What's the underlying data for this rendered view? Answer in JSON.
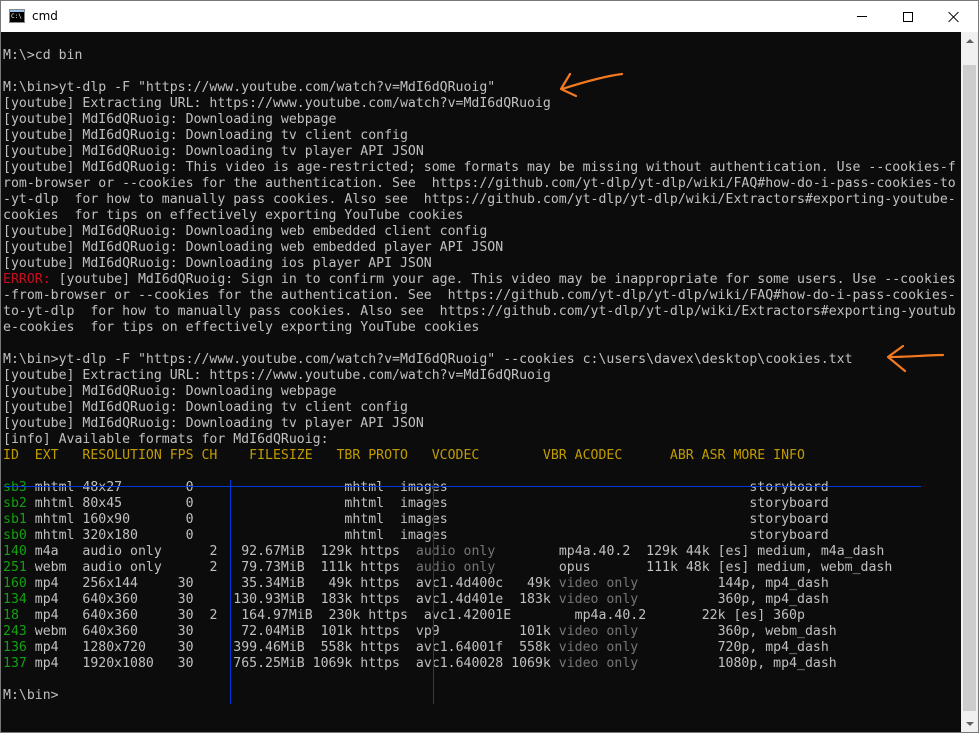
{
  "window": {
    "title": "cmd"
  },
  "colors": {
    "error": "#c50f1f",
    "header": "#c19c00",
    "format_id": "#13a10e",
    "dim": "#767676",
    "separator": "#0037da",
    "annotation": "#f47a1f"
  },
  "terminal": {
    "lines": [
      "M:\\>cd bin",
      "",
      "M:\\bin>yt-dlp -F \"https://www.youtube.com/watch?v=MdI6dQRuoig\"",
      "[youtube] Extracting URL: https://www.youtube.com/watch?v=MdI6dQRuoig",
      "[youtube] MdI6dQRuoig: Downloading webpage",
      "[youtube] MdI6dQRuoig: Downloading tv client config",
      "[youtube] MdI6dQRuoig: Downloading tv player API JSON",
      "[youtube] MdI6dQRuoig: This video is age-restricted; some formats may be missing without authentication. Use --cookies-f",
      "rom-browser or --cookies for the authentication. See  https://github.com/yt-dlp/yt-dlp/wiki/FAQ#how-do-i-pass-cookies-to",
      "-yt-dlp  for how to manually pass cookies. Also see  https://github.com/yt-dlp/yt-dlp/wiki/Extractors#exporting-youtube-",
      "cookies  for tips on effectively exporting YouTube cookies",
      "[youtube] MdI6dQRuoig: Downloading web embedded client config",
      "[youtube] MdI6dQRuoig: Downloading web embedded player API JSON",
      "[youtube] MdI6dQRuoig: Downloading ios player API JSON"
    ],
    "error_label": "ERROR:",
    "error_lines": [
      " [youtube] MdI6dQRuoig: Sign in to confirm your age. This video may be inappropriate for some users. Use --cookies",
      "-from-browser or --cookies for the authentication. See  https://github.com/yt-dlp/yt-dlp/wiki/FAQ#how-do-i-pass-cookies-",
      "to-yt-dlp  for how to manually pass cookies. Also see  https://github.com/yt-dlp/yt-dlp/wiki/Extractors#exporting-youtub",
      "e-cookies  for tips on effectively exporting YouTube cookies"
    ],
    "lines2": [
      "",
      "M:\\bin>yt-dlp -F \"https://www.youtube.com/watch?v=MdI6dQRuoig\" --cookies c:\\users\\davex\\desktop\\cookies.txt",
      "[youtube] Extracting URL: https://www.youtube.com/watch?v=MdI6dQRuoig",
      "[youtube] MdI6dQRuoig: Downloading webpage",
      "[youtube] MdI6dQRuoig: Downloading tv client config",
      "[youtube] MdI6dQRuoig: Downloading tv player API JSON",
      "[info] Available formats for MdI6dQRuoig:"
    ],
    "table_header": "ID  EXT   RESOLUTION FPS CH    FILESIZE   TBR PROTO   VCODEC        VBR ACODEC      ABR ASR MORE INFO",
    "rows": [
      {
        "id": "sb3",
        "a": " mhtml 48x27        0",
        "b": "                   mhtml ",
        "c": " images                                      ",
        "d": "storyboard"
      },
      {
        "id": "sb2",
        "a": " mhtml 80x45        0",
        "b": "                   mhtml ",
        "c": " images                                      ",
        "d": "storyboard"
      },
      {
        "id": "sb1",
        "a": " mhtml 160x90       0",
        "b": "                   mhtml ",
        "c": " images                                      ",
        "d": "storyboard"
      },
      {
        "id": "sb0",
        "a": " mhtml 320x180      0",
        "b": "                   mhtml ",
        "c": " images                                      ",
        "d": "storyboard"
      },
      {
        "id": "140",
        "a": " m4a   audio only      2",
        "b": "   92.67MiB  129k https ",
        "c_dim": " audio only",
        "c": "        mp4a.40.2  129k 44k ",
        "d": "[es] medium, m4a_dash"
      },
      {
        "id": "251",
        "a": " webm  audio only      2",
        "b": "   79.73MiB  111k https ",
        "c_dim": " audio only",
        "c": "        opus       111k 48k ",
        "d": "[es] medium, webm_dash"
      },
      {
        "id": "160",
        "a": " mp4   256x144     30",
        "b": "      35.34MiB   49k https ",
        "c": " avc1.4d400c   49k",
        "c_dim2": " video only",
        "c2": "          ",
        "d": "144p, mp4_dash"
      },
      {
        "id": "134",
        "a": " mp4   640x360     30",
        "b": "     130.93MiB  183k https ",
        "c": " avc1.4d401e  183k",
        "c_dim2": " video only",
        "c2": "          ",
        "d": "360p, mp4_dash"
      },
      {
        "id": "18",
        "a": "  mp4   640x360     30  2",
        "b": "   164.97MiB  230k https ",
        "c": " avc1.42001E        mp4a.40.2       22k ",
        "d": "[es] 360p"
      },
      {
        "id": "243",
        "a": " webm  640x360     30",
        "b": "      72.04MiB  101k https ",
        "c": " vp9          101k",
        "c_dim2": " video only",
        "c2": "          ",
        "d": "360p, webm_dash"
      },
      {
        "id": "136",
        "a": " mp4   1280x720    30",
        "b": "     399.46MiB  558k https ",
        "c": " avc1.64001f  558k",
        "c_dim2": " video only",
        "c2": "          ",
        "d": "720p, mp4_dash"
      },
      {
        "id": "137",
        "a": " mp4   1920x1080   30",
        "b": "     765.25MiB 1069k https ",
        "c": " avc1.640028 1069k",
        "c_dim2": " video only",
        "c2": "          ",
        "d": "1080p, mp4_dash"
      }
    ],
    "prompt_final": "M:\\bin>"
  }
}
